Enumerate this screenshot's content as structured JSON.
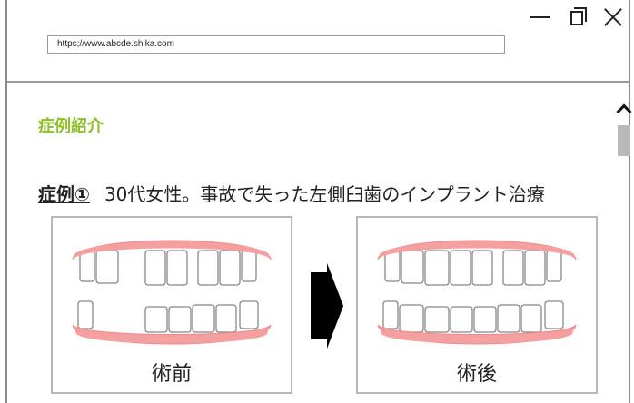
{
  "window": {
    "controls": [
      "minimize",
      "maximize",
      "close"
    ]
  },
  "address_bar": {
    "url": "https;//www.abcde.shika.com"
  },
  "page": {
    "section_title": "症例紹介",
    "case": {
      "label": "症例①",
      "description": "30代女性。事故で失った左側臼歯のインプラント治療"
    },
    "panels": [
      {
        "caption": "術前"
      },
      {
        "caption": "術後"
      }
    ]
  },
  "colors": {
    "accent_green": "#8dbf2d",
    "gum_pink": "#f4a0a0",
    "border_gray": "#b8b8b8"
  },
  "icons": [
    "minimize-icon",
    "maximize-icon",
    "close-icon",
    "scroll-up-icon",
    "right-arrow-icon"
  ]
}
